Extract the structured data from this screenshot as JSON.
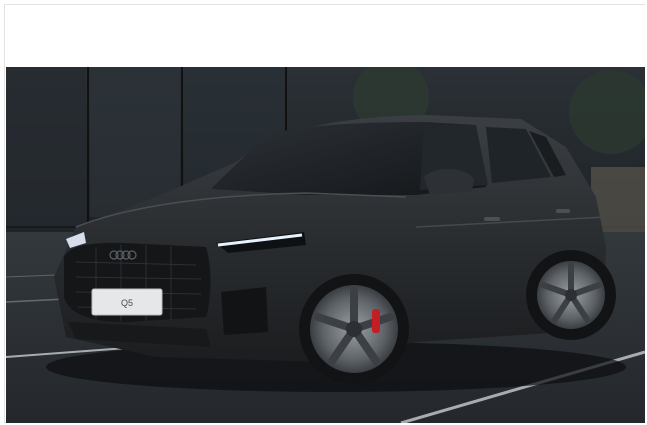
{
  "image": {
    "subject": "Audi Q5",
    "license_plate": "Q5",
    "colors": {
      "body": "#2a2d30",
      "background": "#1c2024",
      "floor": "#2b2f33",
      "headlight": "#e8f2ff",
      "caliper": "#c21f24"
    }
  }
}
